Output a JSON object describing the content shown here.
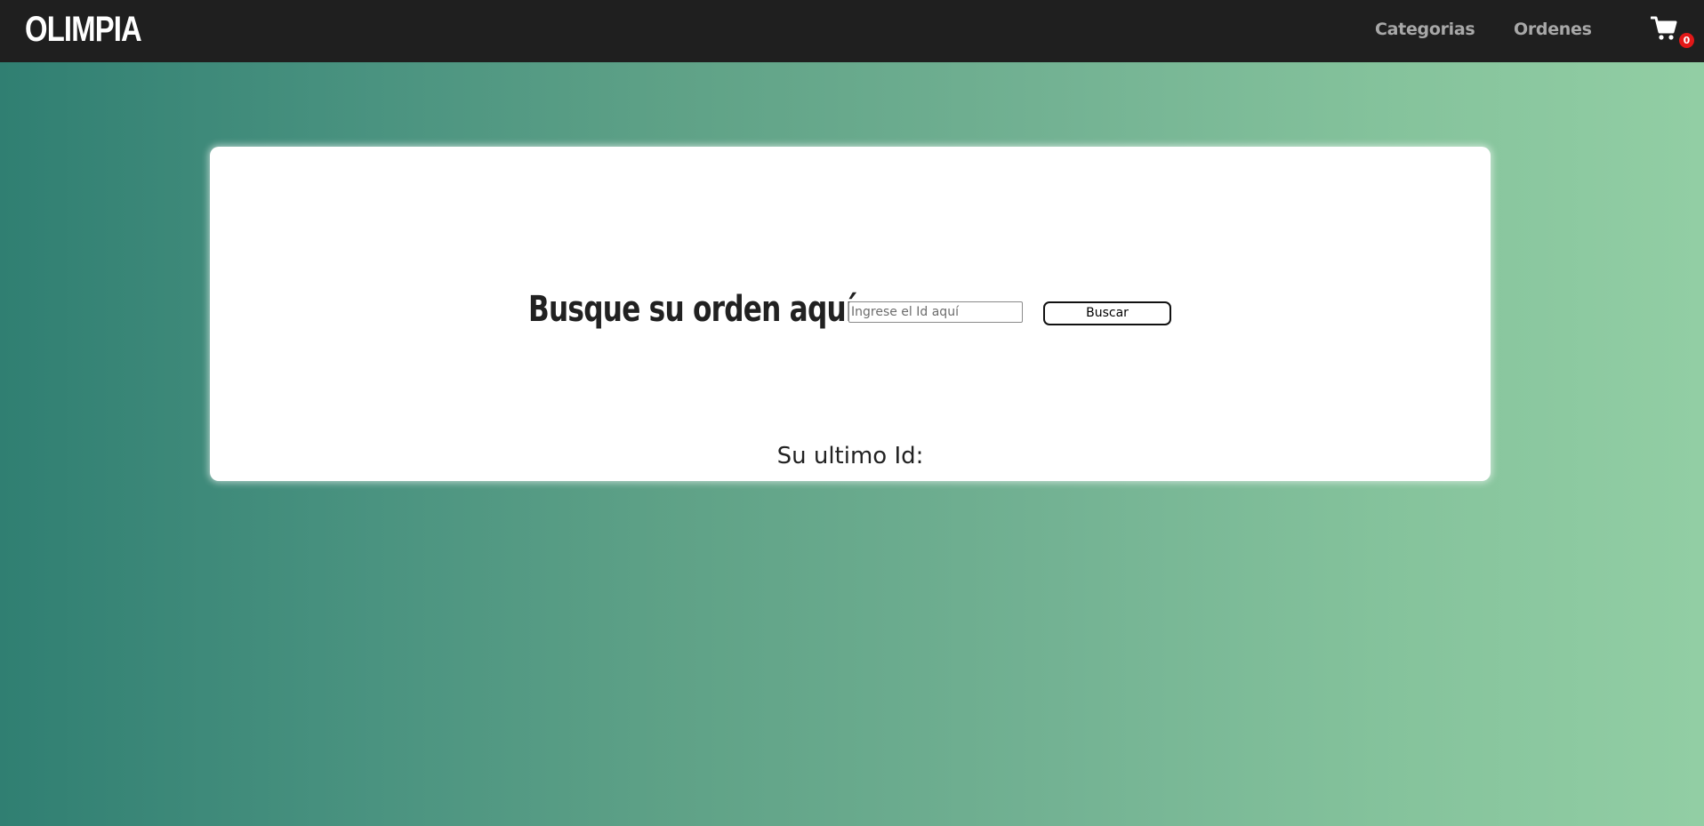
{
  "navbar": {
    "brand": "OLIMPIA",
    "links": [
      {
        "label": "Categorias"
      },
      {
        "label": "Ordenes"
      }
    ],
    "cart": {
      "icon": "shopping-cart-icon",
      "count": "0",
      "badge_color": "#e21818"
    },
    "background": "#1f1f1f"
  },
  "main": {
    "search_title": "Busque su orden aquí:",
    "input": {
      "placeholder": "Ingrese el Id aquí",
      "value": ""
    },
    "search_button": "Buscar",
    "last_id_label": "Su ultimo Id:"
  },
  "theme": {
    "gradient_start": "#307f72",
    "gradient_end": "#92cea4",
    "card_background": "#ffffff"
  }
}
